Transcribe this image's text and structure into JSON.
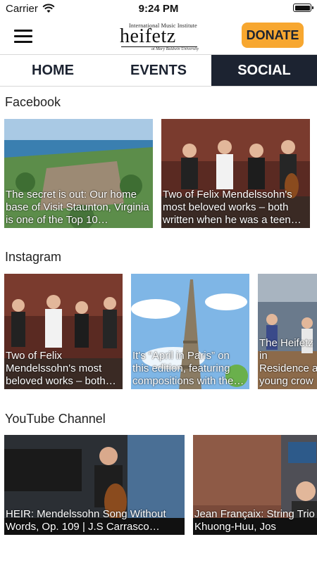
{
  "status_bar": {
    "carrier": "Carrier",
    "time": "9:24 PM"
  },
  "header": {
    "logo_top": "International Music Institute",
    "logo_main": "heifetz",
    "logo_sub": "at Mary Baldwin University",
    "donate_label": "DONATE"
  },
  "tabs": [
    {
      "label": "HOME",
      "active": false
    },
    {
      "label": "EVENTS",
      "active": false
    },
    {
      "label": "SOCIAL",
      "active": true
    }
  ],
  "sections": {
    "facebook": {
      "title": "Facebook",
      "cards": [
        {
          "caption": "The secret is out: Our home base of Visit Staunton, Virginia is one of the Top 10…"
        },
        {
          "caption": "Two of Felix Mendelssohn's most beloved works – both written when he was a teen…"
        }
      ]
    },
    "instagram": {
      "title": "Instagram",
      "cards": [
        {
          "caption": "Two of Felix Mendelssohn's most beloved works – both…"
        },
        {
          "caption": "It's “April in Paris” on this edition, featuring compositions with the…"
        },
        {
          "caption": "The Heifetz in Residence a young crow"
        }
      ]
    },
    "youtube": {
      "title": "YouTube Channel",
      "cards": [
        {
          "caption": "HEIR: Mendelssohn Song Without Words, Op. 109 | J.S Carrasco…"
        },
        {
          "caption": "Jean Françaix: String Trio Fiona Khuong-Huu, Jos"
        }
      ]
    }
  }
}
